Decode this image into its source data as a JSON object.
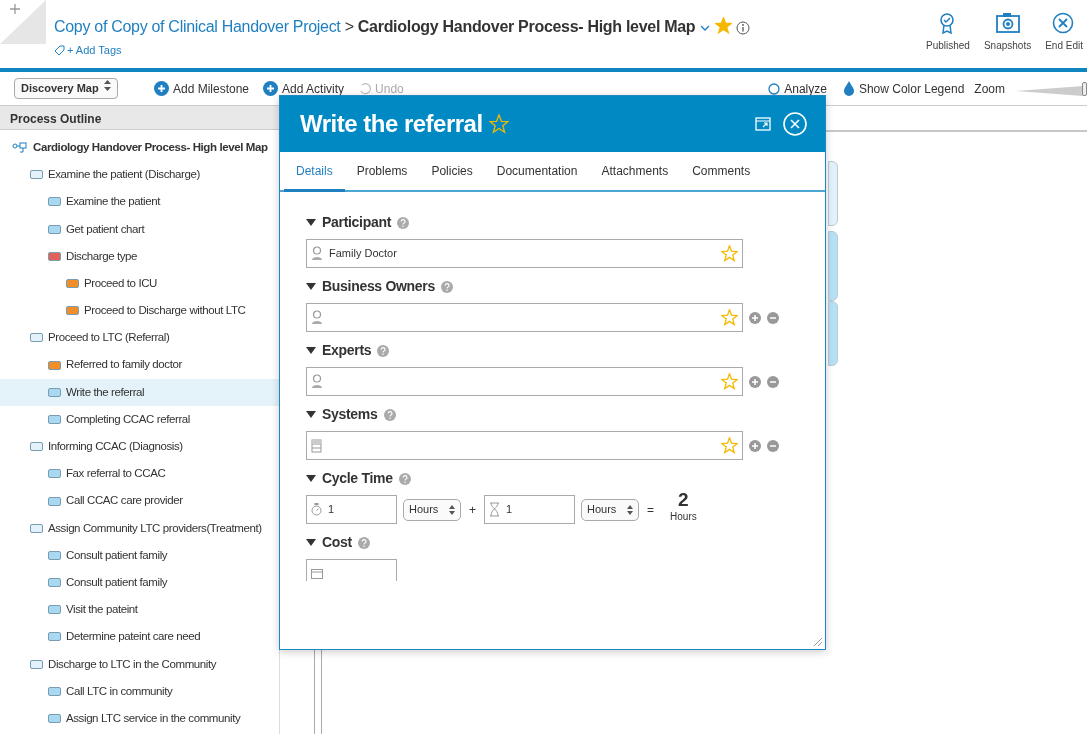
{
  "header": {
    "breadcrumb_parent": "Copy of Copy of Clinical Handover Project",
    "separator": ">",
    "title": "Cardiology Handover Process- High level Map",
    "favorite": true,
    "tags_link": "+ Add Tags",
    "actions": [
      {
        "kind": "published",
        "label": "Published"
      },
      {
        "kind": "snapshots",
        "label": "Snapshots"
      },
      {
        "kind": "end",
        "label": "End Edit"
      }
    ]
  },
  "toolbar": {
    "view_select": "Discovery Map",
    "buttons": [
      {
        "kind": "add",
        "label": "Add Milestone",
        "disabled": false
      },
      {
        "kind": "add",
        "label": "Add Activity",
        "disabled": false
      },
      {
        "kind": "undo",
        "label": "Undo",
        "disabled": true
      }
    ],
    "right": [
      {
        "kind": "analyze",
        "label": "Analyze"
      },
      {
        "kind": "legend",
        "label": "Show Color Legend"
      }
    ],
    "zoom_label": "Zoom",
    "zoom": {
      "level": 1
    }
  },
  "sidebar": {
    "title": "Process Outline",
    "tree": [
      {
        "label": "Cardiology Handover Process- High level Map",
        "selected": false,
        "children": [
          {
            "label": "Examine the patient (Discharge)",
            "color": "#e3f2fa",
            "selected": false,
            "children": [
              {
                "label": "Examine the patient",
                "color": "#a9d9f2",
                "selected": false
              },
              {
                "label": "Get patient chart",
                "color": "#a9d9f2",
                "selected": false
              },
              {
                "label": "Discharge type",
                "color": "#e0625b",
                "selected": false,
                "children": [
                  {
                    "label": "Proceed to ICU",
                    "color": "#f08e2a",
                    "selected": false
                  },
                  {
                    "label": "Proceed to Discharge without LTC",
                    "color": "#f08e2a",
                    "selected": false
                  }
                ]
              }
            ]
          },
          {
            "label": "Proceed to LTC (Referral)",
            "color": "#e3f2fa",
            "selected": false,
            "children": [
              {
                "label": "Referred to family doctor",
                "color": "#f08e2a",
                "selected": false
              },
              {
                "label": "Write the referral",
                "color": "#a9d9f2",
                "selected": true
              },
              {
                "label": "Completing CCAC referral",
                "color": "#a9d9f2",
                "selected": false
              }
            ]
          },
          {
            "label": "Informing CCAC (Diagnosis)",
            "color": "#e3f2fa",
            "selected": false,
            "children": [
              {
                "label": "Fax referral to CCAC",
                "color": "#a9d9f2",
                "selected": false
              },
              {
                "label": "Call CCAC care provider",
                "color": "#a9d9f2",
                "selected": false
              }
            ]
          },
          {
            "label": "Assign Community LTC providers(Treatment)",
            "color": "#e3f2fa",
            "selected": false,
            "children": [
              {
                "label": "Consult patient family",
                "color": "#a9d9f2",
                "selected": false
              },
              {
                "label": "Consult patient family",
                "color": "#a9d9f2",
                "selected": false
              },
              {
                "label": "Visit the pateint",
                "color": "#a9d9f2",
                "selected": false
              },
              {
                "label": "Determine pateint care need",
                "color": "#a9d9f2",
                "selected": false
              }
            ]
          },
          {
            "label": "Discharge to LTC in the Community",
            "color": "#e3f2fa",
            "selected": false,
            "children": [
              {
                "label": "Call LTC in community",
                "color": "#a9d9f2",
                "selected": false
              },
              {
                "label": "Assign LTC service in the community",
                "color": "#a9d9f2",
                "selected": false
              }
            ]
          }
        ]
      }
    ]
  },
  "dialog": {
    "title": "Write the referral",
    "favorite": false,
    "tabs": [
      {
        "label": "Details",
        "selected": true
      },
      {
        "label": "Problems",
        "selected": false
      },
      {
        "label": "Policies",
        "selected": false
      },
      {
        "label": "Documentation",
        "selected": false
      },
      {
        "label": "Attachments",
        "selected": false
      },
      {
        "label": "Comments",
        "selected": false
      }
    ],
    "sections": [
      {
        "kind": "person",
        "label": "Participant",
        "expanded": true,
        "value": "Family Doctor",
        "multi": false
      },
      {
        "kind": "person",
        "label": "Business Owners",
        "expanded": true,
        "multi": true
      },
      {
        "kind": "person",
        "label": "Experts",
        "expanded": true,
        "multi": true
      },
      {
        "kind": "system",
        "label": "Systems",
        "expanded": true,
        "multi": true
      },
      {
        "kind": "cycle",
        "label": "Cycle Time",
        "expanded": true,
        "work": "1",
        "work_unit": "Hours",
        "plus": "+",
        "wait": "1",
        "wait_unit": "Hours",
        "equals": "=",
        "total": "2",
        "total_unit": "Hours"
      },
      {
        "kind": "cost",
        "label": "Cost",
        "expanded": true
      }
    ]
  }
}
